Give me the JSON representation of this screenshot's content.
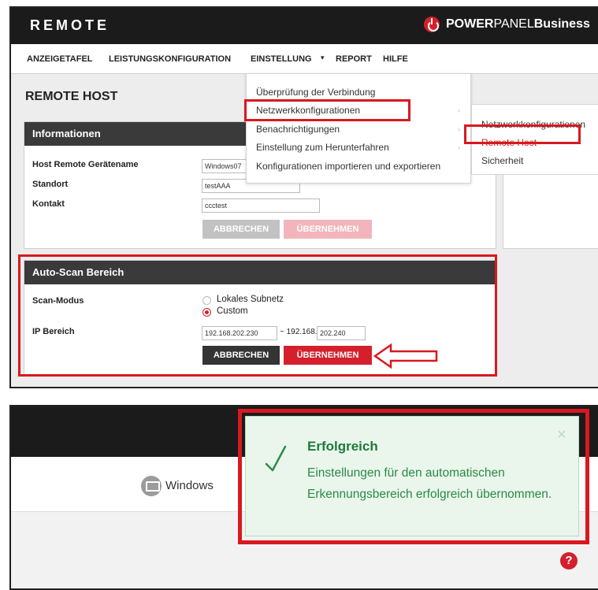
{
  "app": {
    "brand": "REMOTE",
    "product_bold": "POWER",
    "product_rest": "PANEL",
    "product_suffix": " Business"
  },
  "nav": [
    {
      "label": "ANZEIGETAFEL"
    },
    {
      "label": "LEISTUNGSKONFIGURATION"
    },
    {
      "label": "EINSTELLUNG"
    },
    {
      "label": "REPORT"
    },
    {
      "label": "HILFE"
    }
  ],
  "page_title": "REMOTE HOST",
  "dropdown": {
    "items": [
      {
        "label": "Überprüfung der Verbindung"
      },
      {
        "label": "Netzwerkkonfigurationen"
      },
      {
        "label": "Benachrichtigungen"
      },
      {
        "label": "Einstellung zum Herunterfahren"
      },
      {
        "label": "Konfigurationen importieren und exportieren"
      }
    ],
    "submenu": [
      {
        "label": "Netzwerkkonfigurationen"
      },
      {
        "label": "Remote Host"
      },
      {
        "label": "Sicherheit"
      }
    ]
  },
  "info_card": {
    "title": "Informationen",
    "fields": [
      {
        "label": "Host Remote Gerätename",
        "value": "Windows07"
      },
      {
        "label": "Standort",
        "value": "testAAA"
      },
      {
        "label": "Kontakt",
        "value": "ccctest"
      }
    ],
    "cancel": "ABBRECHEN",
    "apply": "ÜBERNEHMEN"
  },
  "autoscan_card": {
    "title": "Auto-Scan Bereich",
    "scan_label": "Scan-Modus",
    "options": [
      {
        "label": "Lokales Subnetz",
        "selected": false
      },
      {
        "label": "Custom",
        "selected": true
      }
    ],
    "ip_label": "IP Bereich",
    "ip_start": "192.168.202.230",
    "ip_sep": "~ 192.168.",
    "ip_end": "202.240",
    "cancel": "ABBRECHEN",
    "apply": "ÜBERNEHMEN"
  },
  "result": {
    "device": "Windows",
    "toast_title": "Erfolgreich",
    "toast_message": "Einstellungen für den automatischen Erkennungsbereich erfolgreich übernommen.",
    "close": "×",
    "help": "?"
  },
  "colors": {
    "accent": "#d4202c",
    "header": "#1b1b1b",
    "success": "#2a8a45"
  }
}
